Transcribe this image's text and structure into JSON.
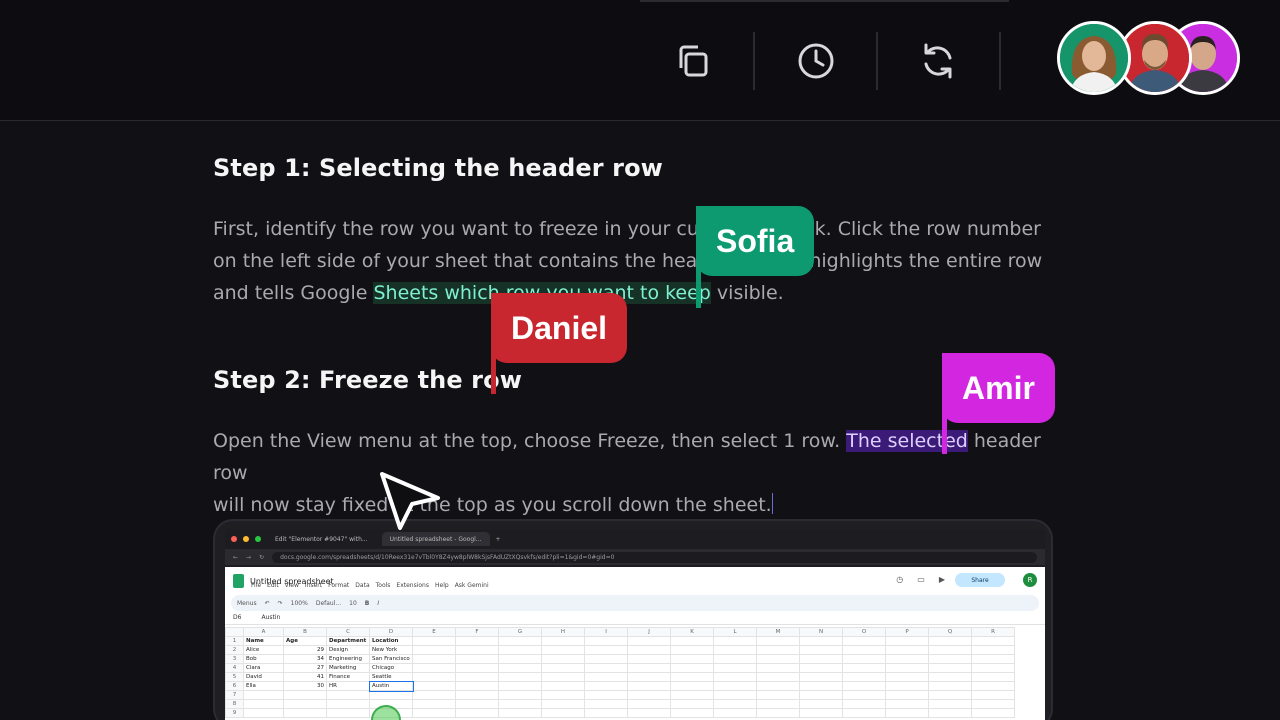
{
  "toolbar": {
    "icons": [
      "copy-icon",
      "history-icon",
      "refresh-icon"
    ]
  },
  "collaborators": [
    {
      "name": "Sofia",
      "color": "#0e9a70"
    },
    {
      "name": "Daniel",
      "color": "#c8272f"
    },
    {
      "name": "Amir",
      "color": "#d226e0"
    }
  ],
  "article": {
    "step1": {
      "heading": "Step 1: Selecting the header row",
      "line1_a": "First, identify the row you want to freeze in your curr",
      "line1_b": "ck. Click the row number",
      "line2_a": "on the left side of your sheet that contains the head",
      "line2_b": "s highlights the entire row",
      "line3_a": "and tells Google ",
      "line3_hl": "Sheets which row you want to keep",
      "line3_b": " visible."
    },
    "step2": {
      "heading": "Step 2: Freeze the row",
      "line1_a": "Open the View menu at the top, choose Freeze, then select 1 row. ",
      "line1_hl": "The selected",
      "line1_b": " header row",
      "line2": "will now stay fixed at the top as you scroll down the sheet."
    }
  },
  "screenshot": {
    "tab1": "Edit \"Elementor #9047\" with...",
    "tab2": "Untitled spreadsheet - Googl...",
    "url": "docs.google.com/spreadsheets/d/10Reex31e7vTbl0Y8Z4yw8plW8kSjsFAdUZtXQsvkfs/edit?pli=1&gid=0#gid=0",
    "doc_title": "Untitled spreadsheet",
    "menus": [
      "File",
      "Edit",
      "View",
      "Insert",
      "Format",
      "Data",
      "Tools",
      "Extensions",
      "Help",
      "Ask Gemini"
    ],
    "share": "Share",
    "user_initial": "R",
    "search": "Menus",
    "zoom": "100%",
    "font": "Defaul...",
    "font_size": "10",
    "cell_ref": "D6",
    "formula": "Austin",
    "columns": [
      "A",
      "B",
      "C",
      "D",
      "E",
      "F",
      "G",
      "H",
      "I",
      "J",
      "K",
      "L",
      "M",
      "N",
      "O",
      "P",
      "Q",
      "R"
    ],
    "rows": [
      [
        "Name",
        "Age",
        "Department",
        "Location"
      ],
      [
        "Alice",
        "29",
        "Design",
        "New York"
      ],
      [
        "Bob",
        "34",
        "Engineering",
        "San Francisco"
      ],
      [
        "Clara",
        "27",
        "Marketing",
        "Chicago"
      ],
      [
        "David",
        "41",
        "Finance",
        "Seattle"
      ],
      [
        "Ella",
        "30",
        "HR",
        "Austin"
      ],
      [
        "",
        "",
        "",
        ""
      ],
      [
        "",
        "",
        "",
        ""
      ],
      [
        "",
        "",
        "",
        ""
      ]
    ]
  }
}
